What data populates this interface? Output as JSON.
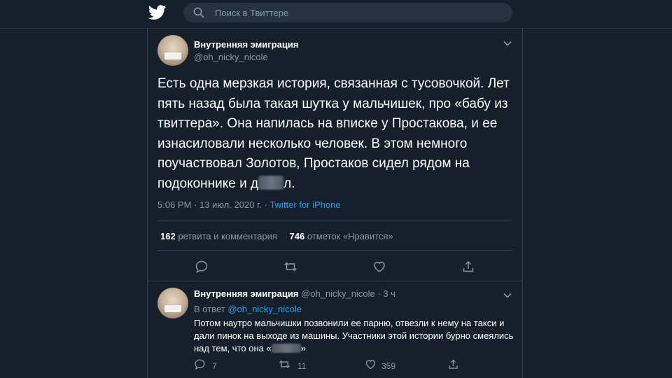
{
  "search": {
    "placeholder": "Поиск в Твиттере"
  },
  "tweet": {
    "name": "Внутренняя эмиграция",
    "handle": "@oh_nicky_nicole",
    "text_main": "Есть одна мерзкая история, связанная с тусовочкой. Лет пять назад была такая шутка у мальчишек, про «бабу из твиттера». Она напилась на вписке у Простакова, и ее изнасиловали несколько человек. В этом немного поучаствовал Золотов, Простаков сидел рядом на подоконнике и д",
    "text_end": "л.",
    "timestamp": "5:06 PM · 13 июл. 2020 г. · ",
    "source": "Twitter for iPhone",
    "retweets_count": "162",
    "retweets_label": "ретвита и комментария",
    "likes_count": "746",
    "likes_label": "отметок «Нравится»"
  },
  "reply": {
    "name": "Внутренняя эмиграция",
    "handle": "@oh_nicky_nicole · 3 ч",
    "reply_prefix": "В ответ ",
    "reply_to": "@oh_nicky_nicole",
    "text_main": "Потом наутро мальчишки позвонили ее парню, отвезли к нему на такси и дали пинок на выходе из машины. Участники этой истории бурно смеялись над тем, что она «",
    "text_end": "»",
    "reply_count": "7",
    "retweet_count": "11",
    "like_count": "359"
  },
  "colors": {
    "background": "#15202b",
    "accent": "#1da1f2",
    "secondary_text": "#8899a6",
    "border": "#38444d"
  },
  "icons": [
    "twitter-bird-icon",
    "search-icon",
    "chevron-down-icon",
    "reply-icon",
    "retweet-icon",
    "like-icon",
    "share-icon"
  ]
}
